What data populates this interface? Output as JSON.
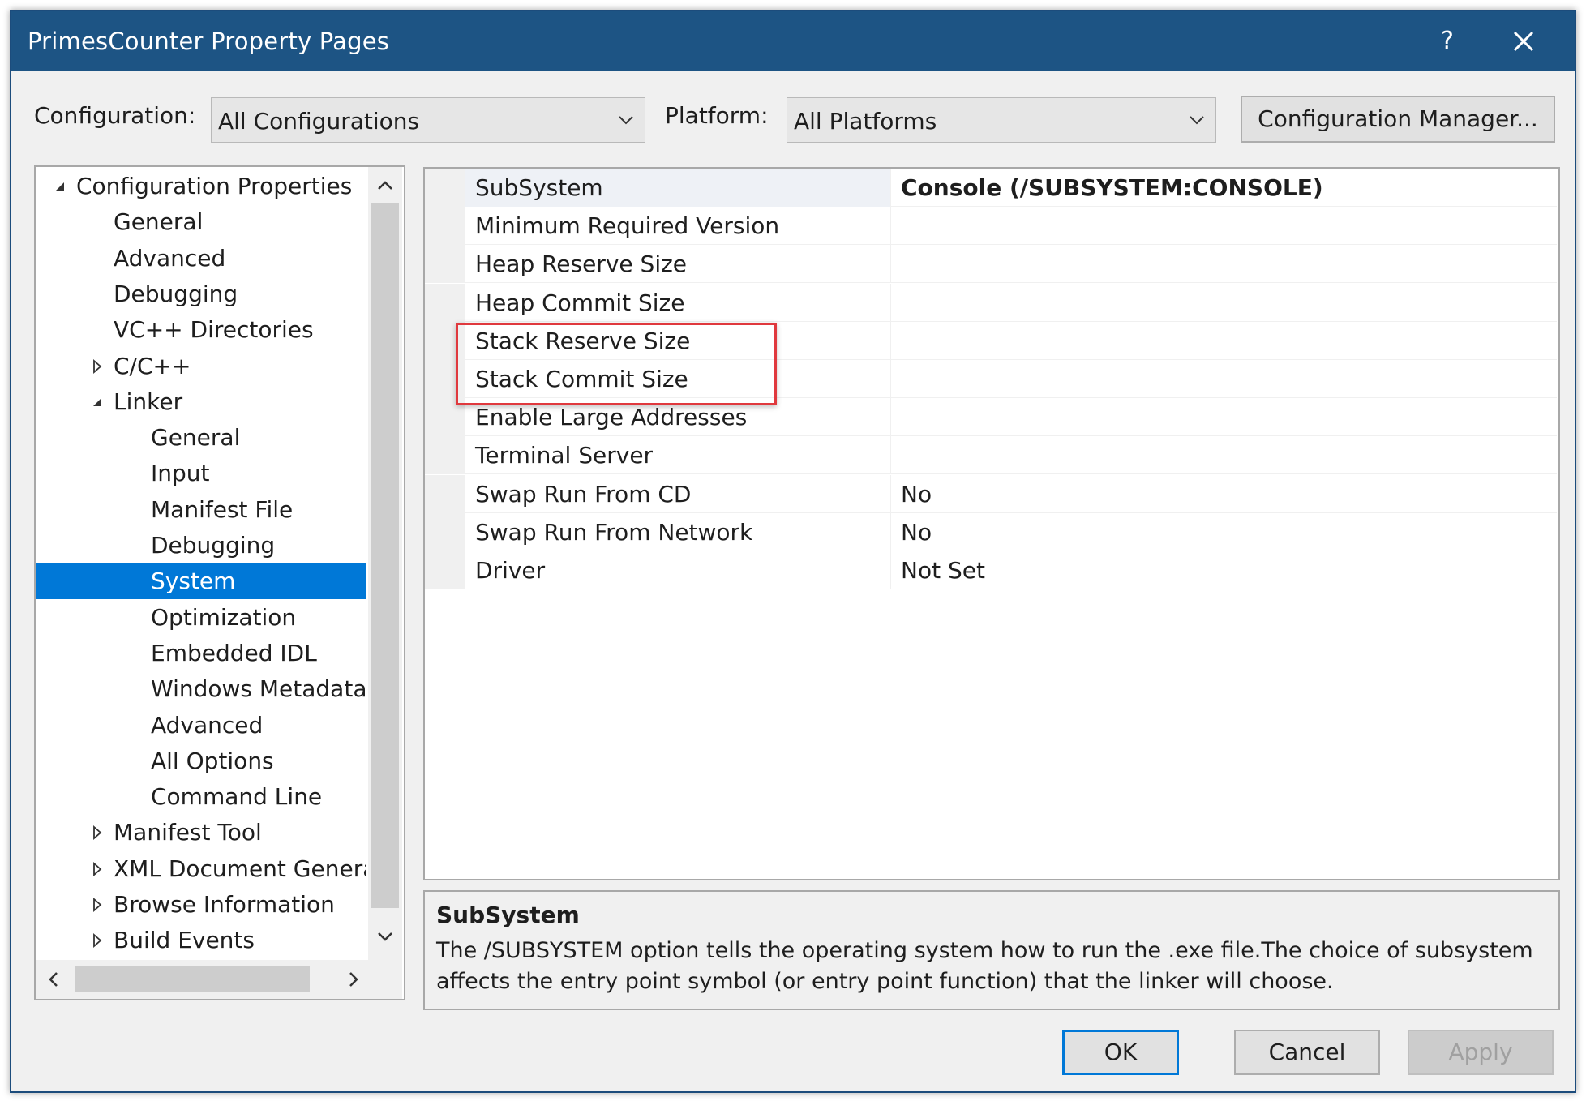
{
  "window": {
    "title": "PrimesCounter Property Pages",
    "help_label": "?",
    "close_icon": "close-icon"
  },
  "toolbar": {
    "configuration_label": "Configuration:",
    "configuration_value": "All Configurations",
    "platform_label": "Platform:",
    "platform_value": "All Platforms",
    "config_manager_label": "Configuration Manager..."
  },
  "tree": {
    "items": [
      {
        "label": "Configuration Properties",
        "expander": "expanded"
      },
      {
        "label": "General",
        "expander": "none"
      },
      {
        "label": "Advanced",
        "expander": "none"
      },
      {
        "label": "Debugging",
        "expander": "none"
      },
      {
        "label": "VC++ Directories",
        "expander": "none"
      },
      {
        "label": "C/C++",
        "expander": "collapsed"
      },
      {
        "label": "Linker",
        "expander": "expanded"
      },
      {
        "label": "General",
        "expander": "none"
      },
      {
        "label": "Input",
        "expander": "none"
      },
      {
        "label": "Manifest File",
        "expander": "none"
      },
      {
        "label": "Debugging",
        "expander": "none"
      },
      {
        "label": "System",
        "expander": "none",
        "selected": true
      },
      {
        "label": "Optimization",
        "expander": "none"
      },
      {
        "label": "Embedded IDL",
        "expander": "none"
      },
      {
        "label": "Windows Metadata",
        "expander": "none"
      },
      {
        "label": "Advanced",
        "expander": "none"
      },
      {
        "label": "All Options",
        "expander": "none"
      },
      {
        "label": "Command Line",
        "expander": "none"
      },
      {
        "label": "Manifest Tool",
        "expander": "collapsed"
      },
      {
        "label": "XML Document Genera",
        "expander": "collapsed"
      },
      {
        "label": "Browse Information",
        "expander": "collapsed"
      },
      {
        "label": "Build Events",
        "expander": "collapsed"
      }
    ]
  },
  "properties": {
    "rows": [
      {
        "name": "SubSystem",
        "value": "Console (/SUBSYSTEM:CONSOLE)",
        "bold": true,
        "active": true
      },
      {
        "name": "Minimum Required Version",
        "value": ""
      },
      {
        "name": "Heap Reserve Size",
        "value": ""
      },
      {
        "name": "Heap Commit Size",
        "value": ""
      },
      {
        "name": "Stack Reserve Size",
        "value": ""
      },
      {
        "name": "Stack Commit Size",
        "value": ""
      },
      {
        "name": "Enable Large Addresses",
        "value": ""
      },
      {
        "name": "Terminal Server",
        "value": ""
      },
      {
        "name": "Swap Run From CD",
        "value": "No"
      },
      {
        "name": "Swap Run From Network",
        "value": "No"
      },
      {
        "name": "Driver",
        "value": "Not Set"
      }
    ],
    "highlight_color": "#e0393e"
  },
  "description": {
    "title": "SubSystem",
    "text": "The /SUBSYSTEM option tells the operating system how to run the .exe file.The choice of subsystem affects the entry point symbol (or entry point function) that the linker will choose."
  },
  "buttons": {
    "ok": "OK",
    "cancel": "Cancel",
    "apply": "Apply"
  },
  "colors": {
    "titlebar": "#1d5484",
    "selection": "#0078d7"
  }
}
